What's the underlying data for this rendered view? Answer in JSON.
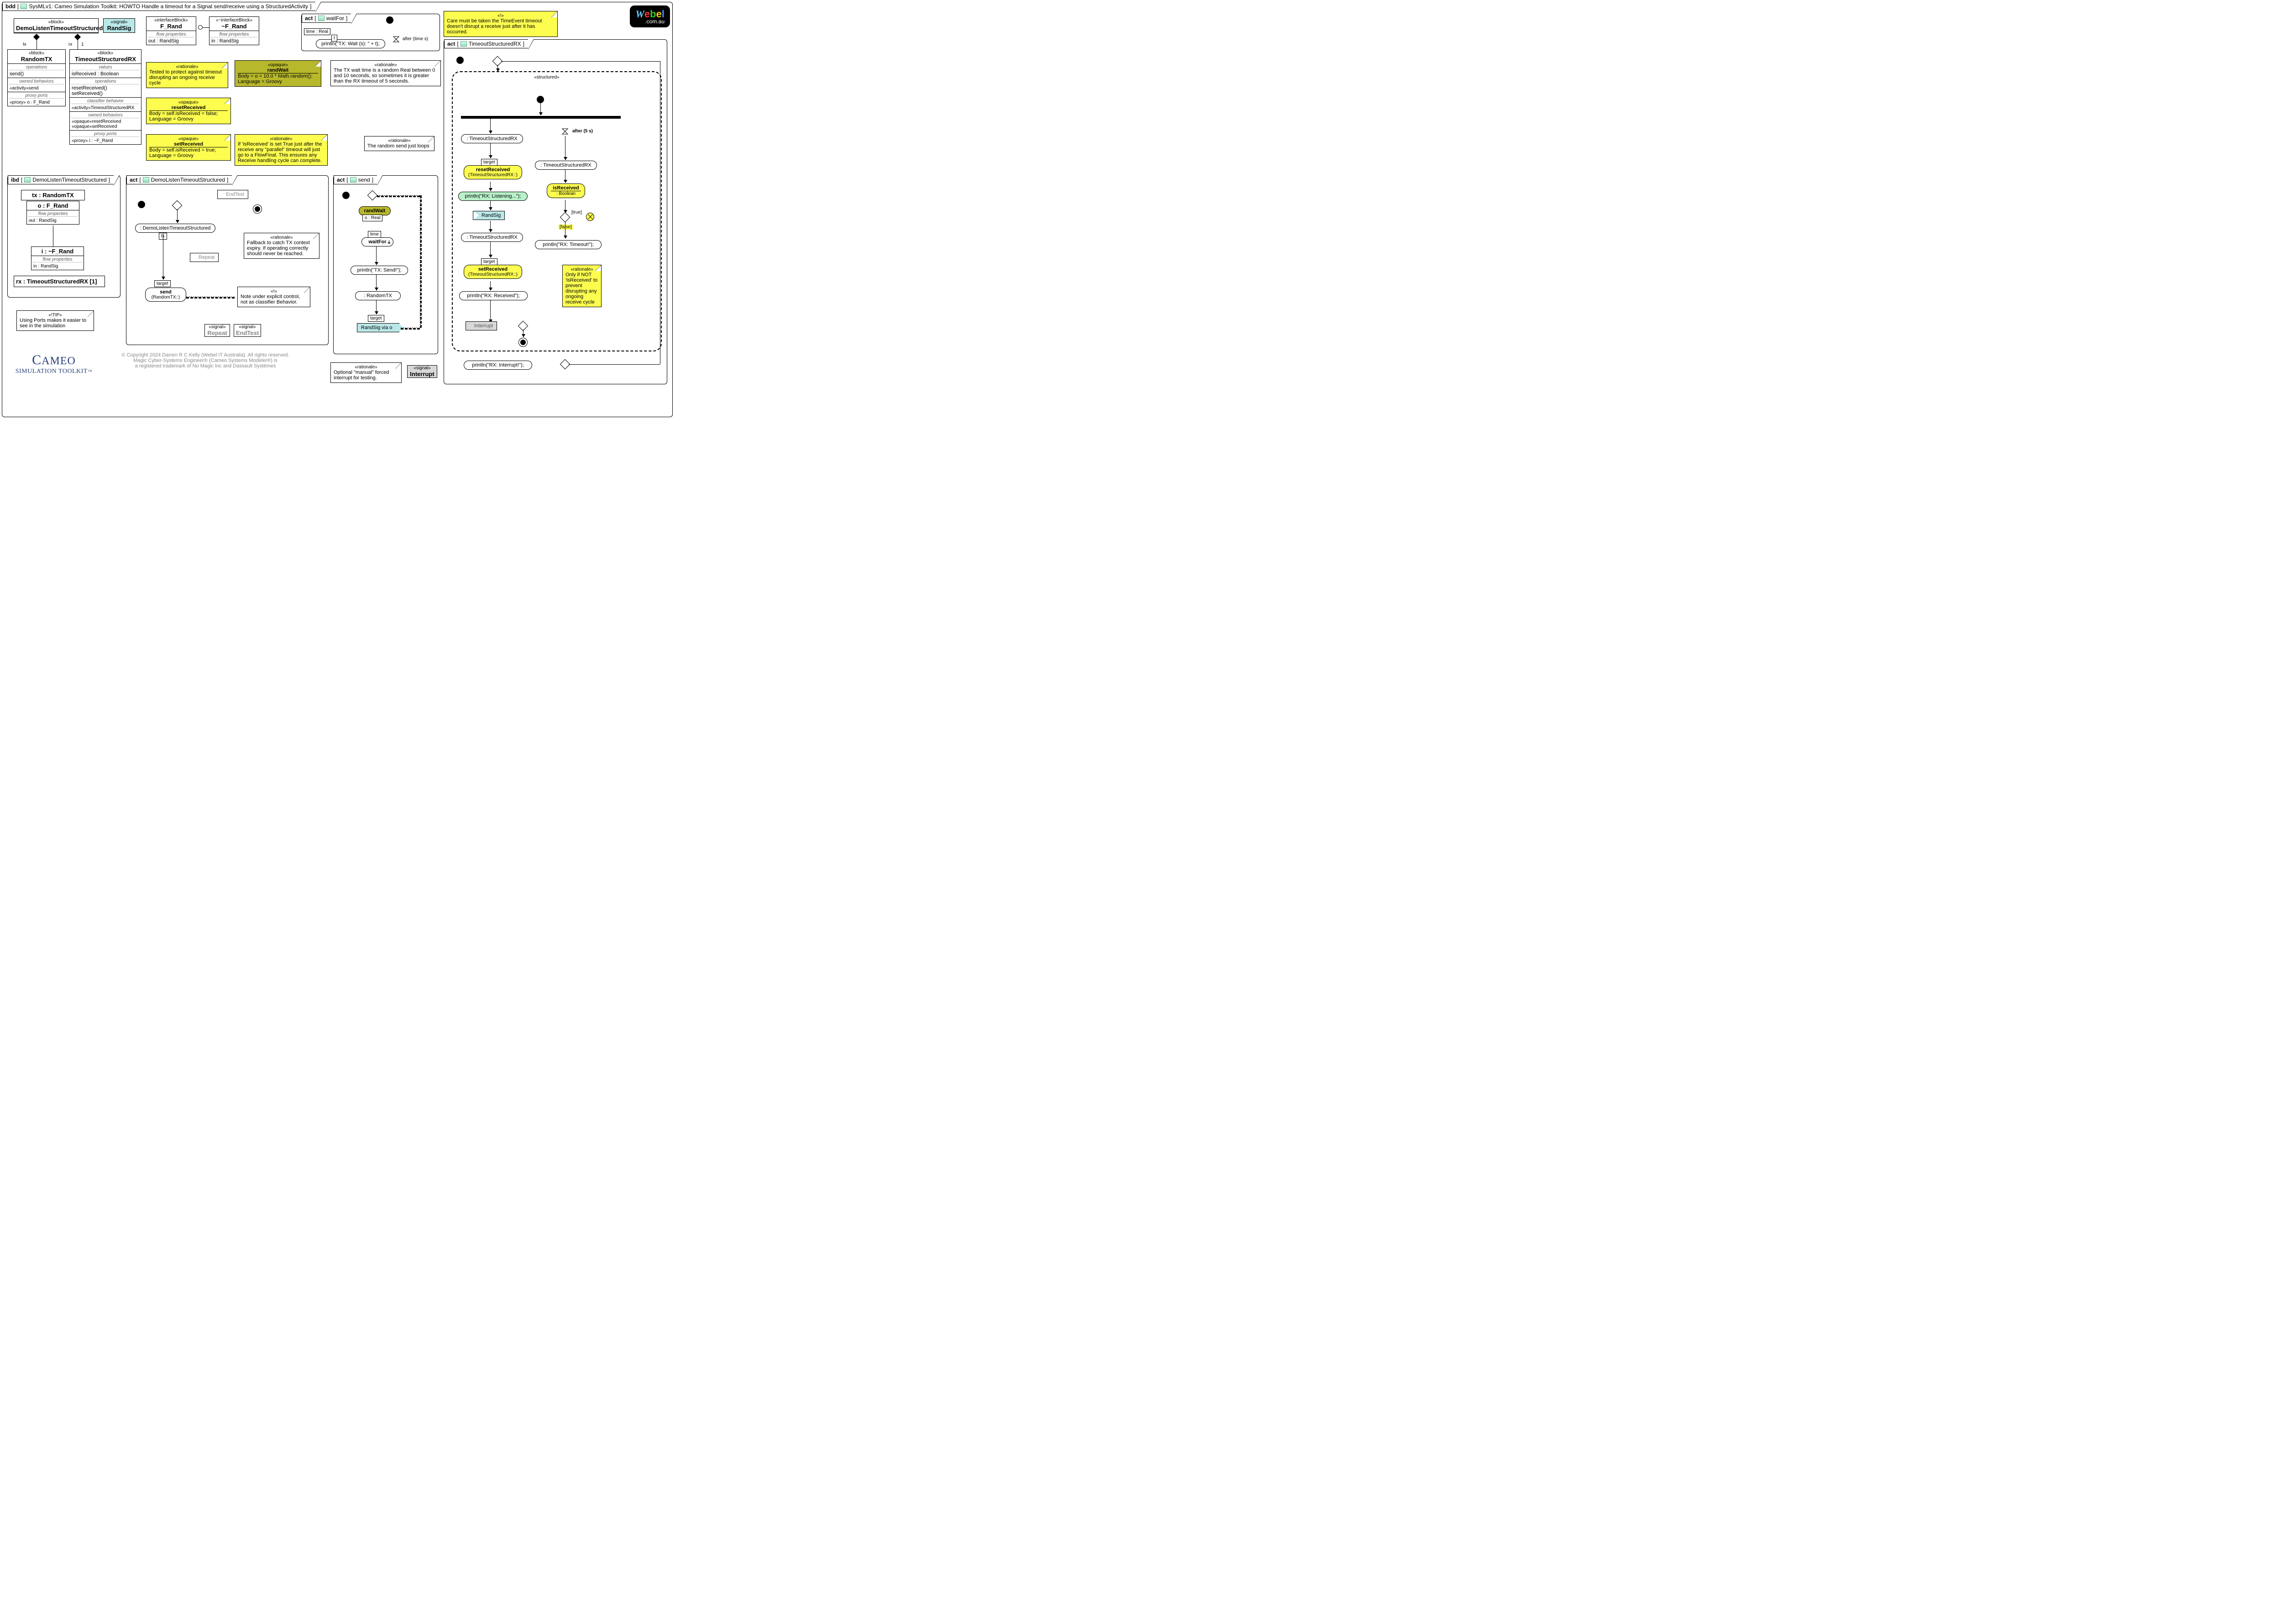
{
  "frame_bdd": {
    "kw": "bdd",
    "title": "SysMLv1: Cameo Simulation Toolkit: HOWTO Handle a timeout for a Signal send/receive using a StructuredActivity"
  },
  "blocks": {
    "demoListen": {
      "st": "«block»",
      "name": "DemoListenTimeoutStructured"
    },
    "randSig": {
      "st": "«signal»",
      "name": "RandSig"
    },
    "fRand": {
      "st": "«interfaceBlock»",
      "name": "F_Rand",
      "fp_head": "flow properties",
      "fp": "out  : RandSig"
    },
    "nfRand": {
      "st": "«~interfaceBlock»",
      "name": "~F_Rand",
      "fp_head": "flow properties",
      "fp": "in  : RandSig"
    },
    "randomTX": {
      "st": "«block»",
      "name": "RandomTX",
      "ops_head": "operations",
      "ops": "send()",
      "ob_head": "owned behaviors",
      "ob": "«activity»send",
      "pp_head": "proxy ports",
      "pp": "«proxy»  o : F_Rand"
    },
    "timeoutRX": {
      "st": "«block»",
      "name": "TimeoutStructuredRX",
      "vals_head": "values",
      "vals": "isReceived : Boolean",
      "ops_head": "operations",
      "ops1": "resetReceived()",
      "ops2": "setReceived()",
      "cb_head": "classifier behavior",
      "cb": "«activity»TimeoutStructuredRX",
      "ob_head": "owned behaviors",
      "ob1": "«opaque»resetReceived",
      "ob2": "«opaque»setReceived",
      "pp_head": "proxy ports",
      "pp": "«proxy»  i : ~F_Rand"
    }
  },
  "assoc": {
    "tx": "tx",
    "rx": "rx",
    "rx_mult": "1"
  },
  "notes": {
    "rationale_test": {
      "st": "«rationale»",
      "body": "Tested to protect against timeout disrupting an ongoing receive cycle"
    },
    "opaque_randWait": {
      "st": "«opaque»",
      "name": "randWait",
      "body": "Body = o = 10.0 * Math.random();\nLanguage = Groovy"
    },
    "opaque_reset": {
      "st": "«opaque»",
      "name": "resetReceived",
      "body": "Body = self.isReceived = false;\nLanguage = Groovy"
    },
    "opaque_set": {
      "st": "«opaque»",
      "name": "setReceived",
      "body": "Body = self.isReceived = true;\nLanguage = Groovy"
    },
    "rationale_txwait": {
      "st": "«rationale»",
      "body": "The TX wait time is a random Real between 0 and 10 seconds, so sometimes it is greater than the RX timeout of 5 seconds."
    },
    "rationale_parallel": {
      "st": "«rationale»",
      "body": "If 'isReceived' is set True just after the receive any \"parallel\" timeout will just go to a FlowFinal. This ensures any Receive handling cycle can complete."
    },
    "rationale_loop": {
      "st": "«rationale»",
      "body": "The random send just loops"
    },
    "rationale_fallback": {
      "st": "«rationale»",
      "body": "Fallback to catch TX context expiry. If operating correctly should never be reached."
    },
    "bang_noteunder": {
      "st": "«!»",
      "body": "Note under explicit control, not as classifier Behavior."
    },
    "tip_ports": {
      "st": "«!TIP»",
      "body": "Using Ports makes it easier to see in the simulation"
    },
    "bang_care": {
      "st": "«!»",
      "body": "Care must be taken the TimeEvent timeout doesn't disrupt a receive just after it has occurred."
    },
    "rationale_onlyif": {
      "st": "«rationale»",
      "body": "Only if NOT 'isReceived' to prevent disrupting any ongoing receive cycle"
    },
    "rationale_manual": {
      "st": "«rationale»",
      "body": "Optional \"manual\" forced interrupt for testing."
    }
  },
  "ibd": {
    "kw": "ibd",
    "name": "DemoListenTimeoutStructured",
    "tx": "tx : RandomTX",
    "o": "o : F_Rand",
    "o_fp_head": "flow properties",
    "o_fp": "out  : RandSig",
    "i": "i : ~F_Rand",
    "i_fp_head": "flow properties",
    "i_fp": "in  : RandSig",
    "rx": "rx : TimeoutStructuredRX [1]"
  },
  "act_demo": {
    "kw": "act",
    "name": "DemoListenTimeoutStructured",
    "read": " : DemoListenTimeoutStructured",
    "tx_pin": "tx",
    "target": "target",
    "send": "send",
    "send_ctx": "(RandomTX::)",
    "endTest": "EndTest",
    "repeat": "Repeat",
    "sig1_st": "«signal»",
    "sig1": "Repeat",
    "sig2_st": "«signal»",
    "sig2": "EndTest"
  },
  "act_waitFor": {
    "kw": "act",
    "name": "waitFor",
    "time": "time : Real",
    "t": "t",
    "println": "println(\"TX: Wait (s): \" + t);",
    "after": "after (time s)"
  },
  "act_send": {
    "kw": "act",
    "name": "send",
    "randWait": "randWait",
    "o": "o : Real",
    "time": "time",
    "waitFor": "waitFor",
    "print": "println(\"TX: Send!\");",
    "readRTX": " : RandomTX",
    "target": "target",
    "sig": "RandSig via o"
  },
  "act_rx": {
    "kw": "act",
    "name": "TimeoutStructuredRX",
    "structured": "«structured»",
    "readRX1": " : TimeoutStructuredRX",
    "target": "target",
    "reset": "resetReceived",
    "reset_ctx": "(TimeoutStructuredRX::)",
    "listen": "println(\"RX: Listening...\");",
    "randSig": "RandSig",
    "readRX2": " : TimeoutStructuredRX",
    "set": "setReceived",
    "set_ctx": "(TimeoutStructuredRX::)",
    "recvd": "println(\"RX: Received\");",
    "after5": "after (5 s)",
    "readRX3": " : TimeoutStructuredRX",
    "isRecv": "isReceived",
    "isRecv_t": " : Boolean",
    "gTrue": "[true]",
    "gFalse": "[false]",
    "timeout": "println(\"RX: Timeout!\");",
    "interrupt_in": "Interrupt",
    "interrupt_out": "println(\"RX: Interrupt!\");",
    "sig_int_st": "«signal»",
    "sig_int": "Interrupt"
  },
  "footer": {
    "l1": "© Copyright 2024 Darren R C Kelly (Webel IT Australia). All rights reserved.",
    "l2": "Magic Cyber-Systems Engineer® (Cameo Systems Modeler®) is",
    "l3": "a registered trademark of No Magic Inc and Dassault Systèmes"
  },
  "logo": {
    "brand": "Webel",
    "domain": ".com.au"
  },
  "cameo": {
    "top": "CAMEO",
    "bot": "SIMULATION TOOLKIT",
    "tm": "™"
  }
}
